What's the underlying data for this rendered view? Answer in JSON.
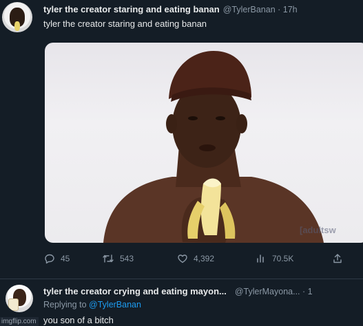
{
  "tweet1": {
    "name": "tyler the creator staring and eating banan",
    "handle_time": "@TylerBanan · 17h",
    "text": "tyler the creator staring and eating banan",
    "media_watermark": "[adultsw",
    "actions": {
      "reply_count": "45",
      "retweet_count": "543",
      "like_count": "4,392",
      "view_count": "70.5K"
    }
  },
  "tweet2": {
    "name": "tyler the creator crying and eating mayon...",
    "handle_time": "@TylerMayona... · 1",
    "replying_prefix": "Replying to",
    "replying_handle": "@TylerBanan",
    "text": "you son of a bitch"
  },
  "watermark": "imgflip.com",
  "colors": {
    "background": "#141d26",
    "primary_text": "#e7e9ea",
    "secondary_text": "#8b98a5",
    "accent": "#1d9bf0"
  },
  "icons": [
    "reply-icon",
    "retweet-icon",
    "like-icon",
    "views-icon",
    "share-icon"
  ]
}
